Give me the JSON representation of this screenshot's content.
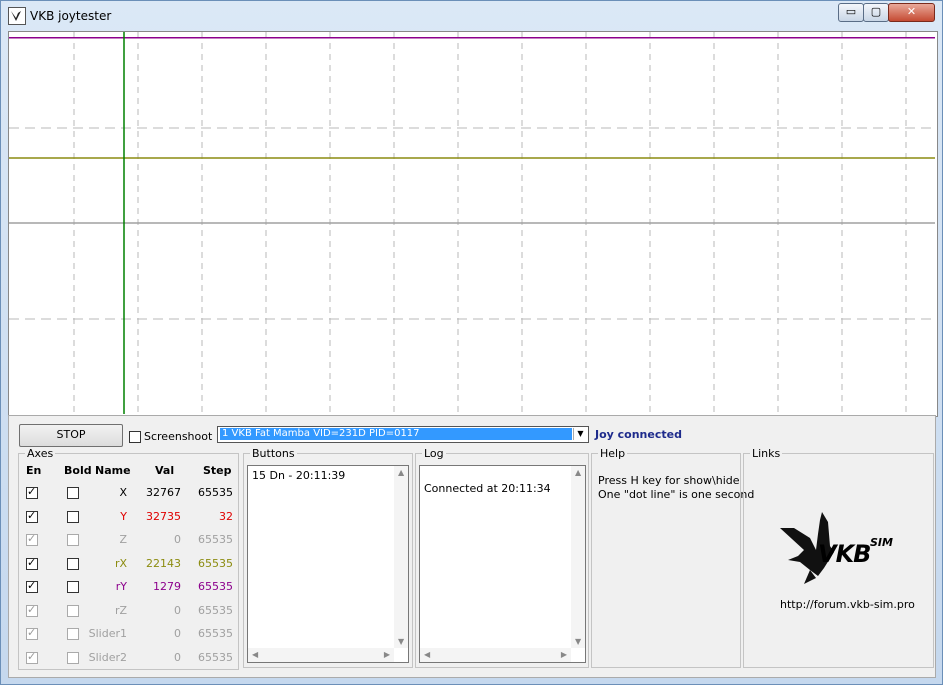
{
  "window": {
    "title": "VKB joytester",
    "controls": {
      "minimize": "▭",
      "maximize": "▢",
      "close": "✕"
    }
  },
  "toolbar": {
    "stop_label": "STOP",
    "screenshoot_label": "Screenshoot",
    "device_selected": "1 VKB Fat Mamba    VID=231D PID=0117",
    "status": "Joy connected",
    "status_color": "#1e2b8c"
  },
  "axes": {
    "title": "Axes",
    "headers": {
      "en": "En",
      "bold": "Bold",
      "name": "Name",
      "val": "Val",
      "step": "Step"
    },
    "rows": [
      {
        "name": "X",
        "val": "32767",
        "step": "65535",
        "en": true,
        "bold": false,
        "enabled": true,
        "color": "#000000"
      },
      {
        "name": "Y",
        "val": "32735",
        "step": "32",
        "en": true,
        "bold": false,
        "enabled": true,
        "color": "#e00000"
      },
      {
        "name": "Z",
        "val": "0",
        "step": "65535",
        "en": true,
        "bold": false,
        "enabled": false,
        "color": "#a0a0a0"
      },
      {
        "name": "rX",
        "val": "22143",
        "step": "65535",
        "en": true,
        "bold": false,
        "enabled": true,
        "color": "#8c8c10"
      },
      {
        "name": "rY",
        "val": "1279",
        "step": "65535",
        "en": true,
        "bold": false,
        "enabled": true,
        "color": "#8c008c"
      },
      {
        "name": "rZ",
        "val": "0",
        "step": "65535",
        "en": true,
        "bold": false,
        "enabled": false,
        "color": "#a0a0a0"
      },
      {
        "name": "Slider1",
        "val": "0",
        "step": "65535",
        "en": true,
        "bold": false,
        "enabled": false,
        "color": "#a0a0a0"
      },
      {
        "name": "Slider2",
        "val": "0",
        "step": "65535",
        "en": true,
        "bold": false,
        "enabled": false,
        "color": "#a0a0a0"
      }
    ]
  },
  "buttons_panel": {
    "title": "Buttons",
    "items": [
      "15 Dn - 20:11:39"
    ]
  },
  "log_panel": {
    "title": "Log",
    "items": [
      "Connected at 20:11:34"
    ]
  },
  "help_panel": {
    "title": "Help",
    "lines": [
      "Press H key for show\\hide",
      "One \"dot line\" is one second"
    ]
  },
  "links_panel": {
    "title": "Links",
    "logo_text": "VKB",
    "logo_sub": "SIM",
    "url": "http://forum.vkb-sim.pro"
  },
  "graph_colors": {
    "x_trace": "#8c008c",
    "rx_trace": "#8c8c10",
    "cursor": "#008000",
    "grid": "#b8b8b8",
    "center": "#a0a0a0"
  },
  "graph_traces": {
    "x_level_fraction": 0.985,
    "rx_level_fraction": 0.67
  }
}
